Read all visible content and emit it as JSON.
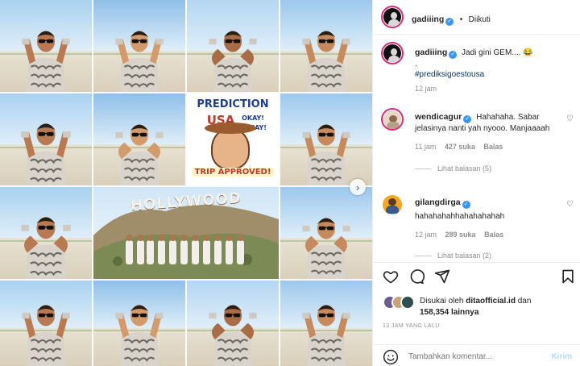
{
  "header": {
    "username": "gadiiing",
    "separator": "•",
    "follow_status": "Diikuti",
    "more_label": "•••"
  },
  "caption": {
    "username": "gadiiing",
    "text": "Jadi gini GEM....",
    "emoji": "😂",
    "line2": ".",
    "hashtag": "#prediksigoestousa",
    "time": "12 jam"
  },
  "comments": [
    {
      "username": "wendicagur",
      "text": "Hahahaha. Sabar jelasinya nanti yah nyooo. Manjaaaah",
      "time": "11 jam",
      "likes": "427 suka",
      "reply": "Balas",
      "view_replies": "Lihat balasan (5)"
    },
    {
      "username": "gilangdirga",
      "text": "hahahahahhahahahahah",
      "time": "12 jam",
      "likes": "289 suka",
      "reply": "Balas",
      "view_replies": "Lihat balasan (2)"
    }
  ],
  "likes": {
    "prefix": "Disukai oleh",
    "user": "ditaofficial.id",
    "conj": "dan",
    "count": "158,354",
    "suffix": "lainnya"
  },
  "post_time": "13 JAM YANG LALU",
  "comment_box": {
    "placeholder": "Tambahkan komentar...",
    "send_label": "Kirim"
  },
  "media": {
    "poster_lines": [
      "PREDICTION",
      "USA",
      "OKAY!",
      "OKAY!",
      "TRIP APPROVED!"
    ],
    "sign_text": "HOLLYWOOD",
    "next_icon": "chevron-right-icon"
  },
  "icons": [
    "heart-icon",
    "comment-icon",
    "share-icon",
    "bookmark-icon",
    "emoji-icon",
    "verified-icon"
  ],
  "colors": {
    "verified": "#3897f0",
    "story_ring": "#dd2a7b",
    "hashtag": "#00376b",
    "muted": "#8e8e8e",
    "send_disabled": "#b3dbff"
  }
}
